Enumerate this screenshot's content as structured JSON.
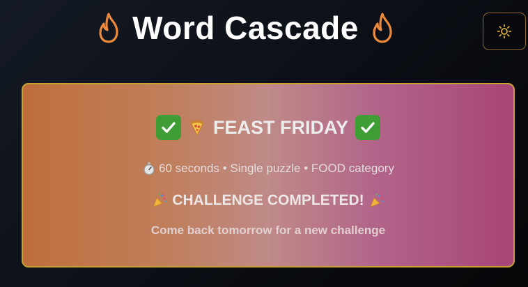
{
  "header": {
    "title": "Word Cascade",
    "left_icon": "flame-icon",
    "right_icon": "flame-icon"
  },
  "theme_toggle": {
    "icon": "sun-icon"
  },
  "challenge": {
    "title": "FEAST FRIDAY",
    "title_icons": [
      "check-icon",
      "pizza-icon",
      "check-icon"
    ],
    "meta": "60 seconds • Single puzzle • FOOD category",
    "meta_icon": "stopwatch-icon",
    "status": "CHALLENGE COMPLETED!",
    "status_icon": "party-popper-icon",
    "message": "Come back tomorrow for a new challenge"
  },
  "colors": {
    "background": "#0b0e14",
    "flame": "#ee8a3c",
    "card_border": "#c9a233",
    "card_gradient_start": "#bf6e3c",
    "card_gradient_end": "#a84575",
    "check_green": "#3f9d35",
    "toggle_border": "#8a6a2a"
  }
}
